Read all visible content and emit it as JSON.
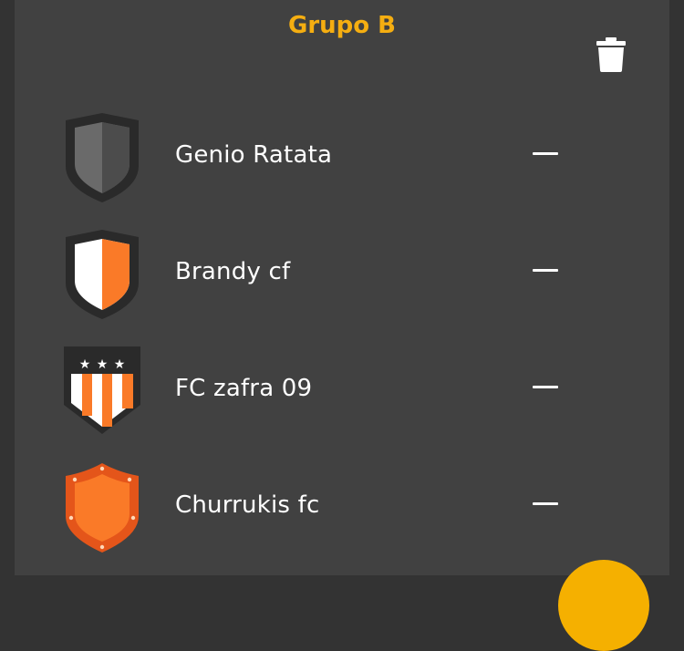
{
  "group": {
    "title": "Grupo B"
  },
  "actions": {
    "delete_icon": "trash-icon",
    "fab_color": "#F5B000"
  },
  "teams": [
    {
      "name": "Genio Ratata",
      "crest": "shield-gray-crest-icon",
      "value": "—"
    },
    {
      "name": "Brandy cf",
      "crest": "shield-white-orange-crest-icon",
      "value": "—"
    },
    {
      "name": "FC zafra 09",
      "crest": "shield-striped-stars-crest-icon",
      "value": "—"
    },
    {
      "name": "Churrukis fc",
      "crest": "shield-orange-studded-crest-icon",
      "value": "—"
    }
  ],
  "colors": {
    "accent": "#F5AE11",
    "orange": "#FA7A28",
    "background": "#414141"
  }
}
